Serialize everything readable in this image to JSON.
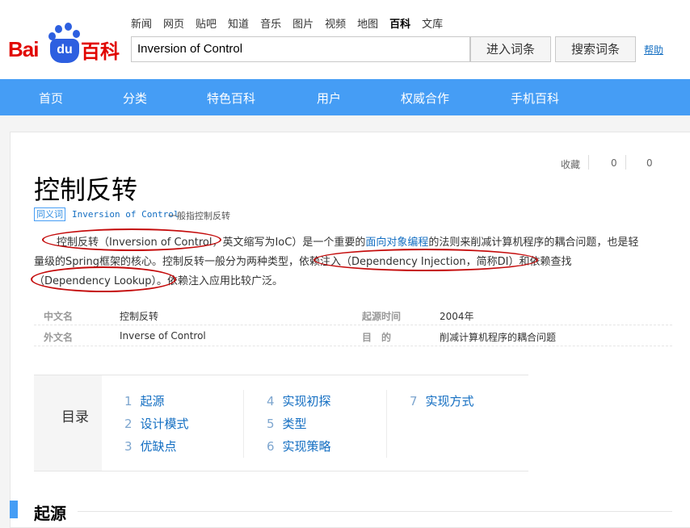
{
  "header": {
    "logo": {
      "bai": "Bai",
      "du": "du",
      "baike": "百科"
    },
    "topnav": [
      "新闻",
      "网页",
      "贴吧",
      "知道",
      "音乐",
      "图片",
      "视频",
      "地图",
      "百科",
      "文库"
    ],
    "active_topnav": "百科",
    "search_value": "Inversion of Control",
    "enter_button": "进入词条",
    "search_button": "搜索词条",
    "help_link": "帮助"
  },
  "mainnav": [
    "首页",
    "分类",
    "特色百科",
    "用户",
    "权威合作",
    "手机百科"
  ],
  "stats": {
    "favorite_label": "收藏",
    "count1": "0",
    "count2": "0"
  },
  "entry": {
    "title": "控制反转",
    "synonym_tag": "同义词",
    "synonym_term": "Inversion of Control",
    "synonym_rest": "一般指控制反转",
    "summary": {
      "p1_a": "控制反转（Inversion of Control，英文缩写为IoC）是一个重要的",
      "p1_link": "面向对象编程",
      "p1_b": "的法则来削减计算机程序的耦合问题，也是轻",
      "p2": "量级的Spring框架的核心。控制反转一般分为两种类型，依赖注入（Dependency Injection，简称DI）和依赖查找",
      "p3": "（Dependency Lookup）。依赖注入应用比较广泛。"
    },
    "info": [
      {
        "label": "中文名",
        "value": "控制反转",
        "label2": "起源时间",
        "value2": "2004年"
      },
      {
        "label": "外文名",
        "value": "Inverse of Control",
        "label2": "目　的",
        "value2": "削减计算机程序的耦合问题"
      }
    ]
  },
  "toc": {
    "label": "目录",
    "items": [
      {
        "num": "1",
        "text": "起源"
      },
      {
        "num": "2",
        "text": "设计模式"
      },
      {
        "num": "3",
        "text": "优缺点"
      },
      {
        "num": "4",
        "text": "实现初探"
      },
      {
        "num": "5",
        "text": "类型"
      },
      {
        "num": "6",
        "text": "实现策略"
      },
      {
        "num": "7",
        "text": "实现方式"
      }
    ]
  },
  "section": {
    "title": "起源"
  },
  "colors": {
    "nav_blue": "#459df5",
    "link_blue": "#136ec2",
    "logo_red": "#e10601",
    "annotation_red": "#c40a0a"
  }
}
